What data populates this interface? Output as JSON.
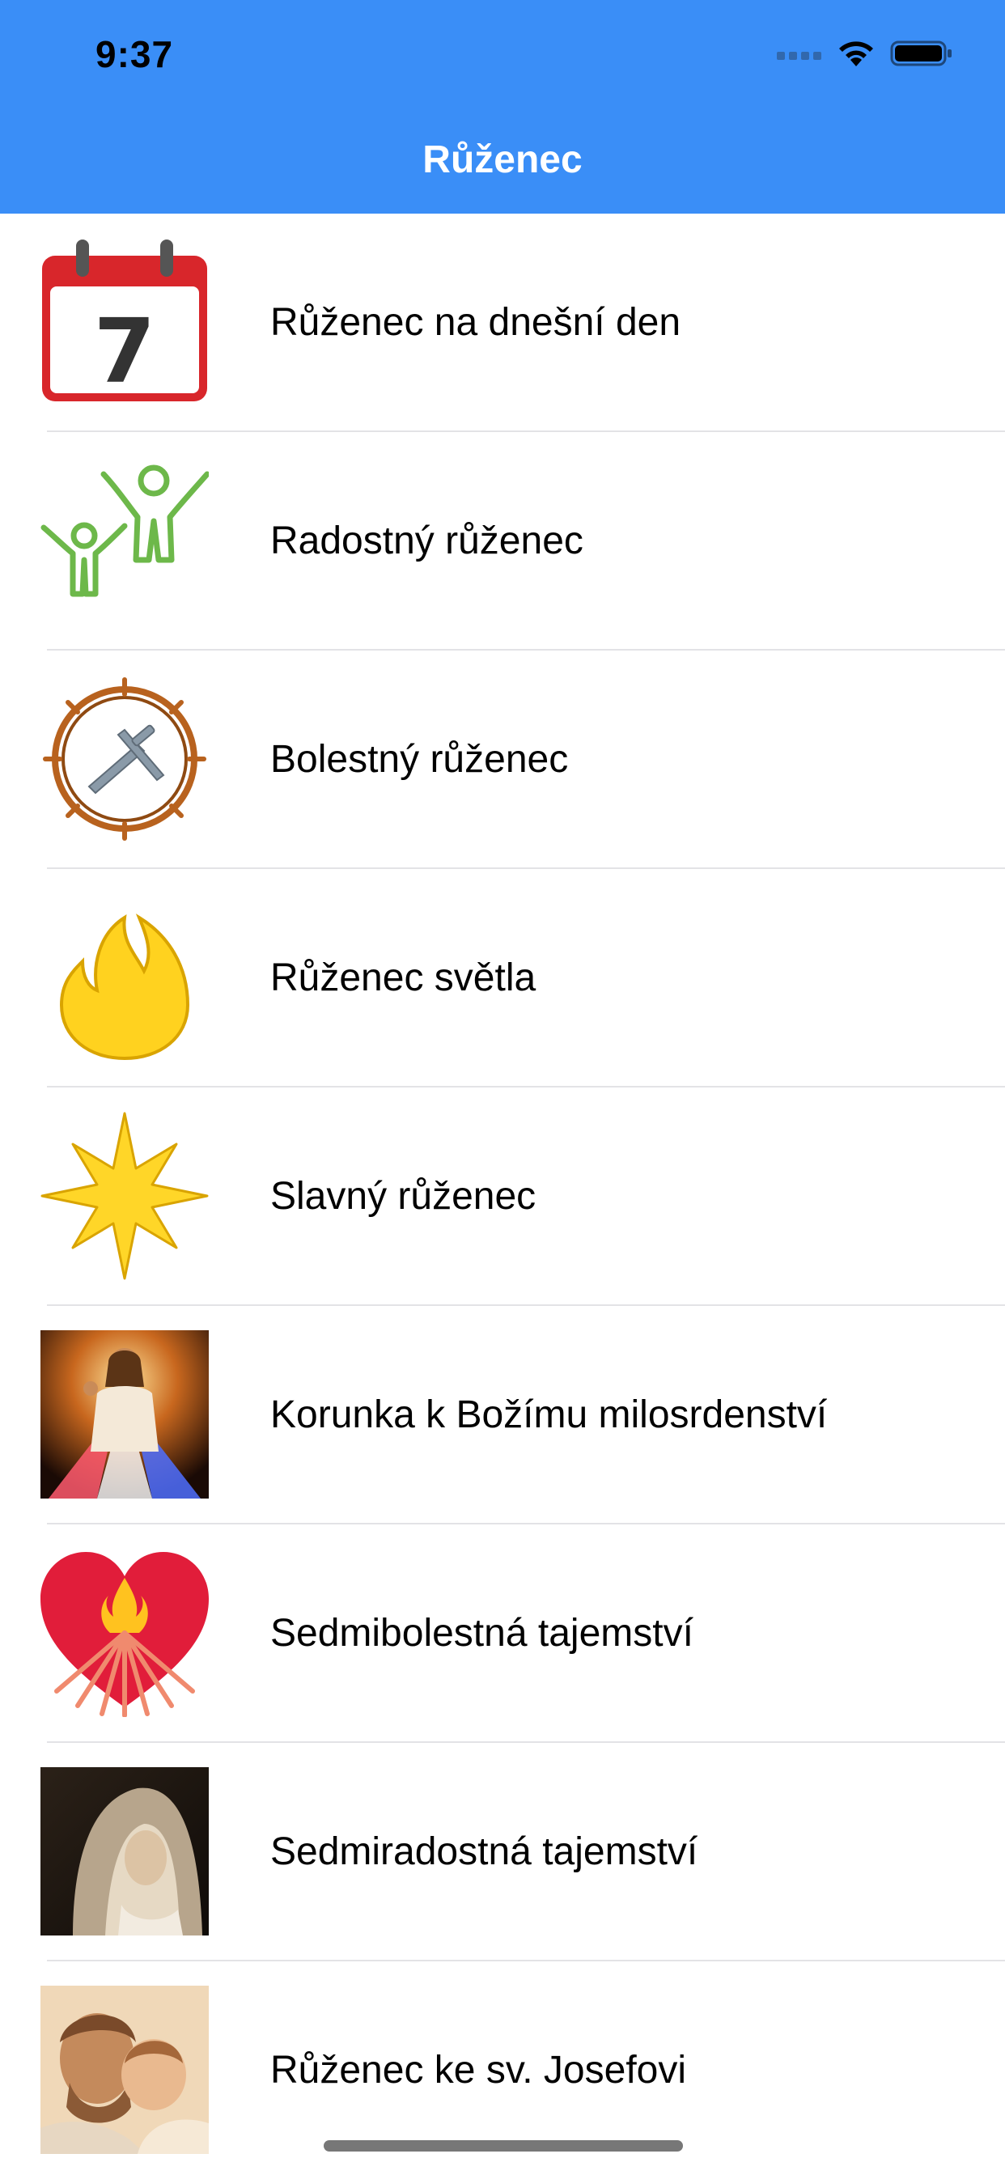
{
  "status_bar": {
    "time": "9:37"
  },
  "nav": {
    "title": "Růženec"
  },
  "calendar_icon_day": "7",
  "items": [
    {
      "label": "Růženec na dnešní den",
      "icon": "calendar-icon"
    },
    {
      "label": "Radostný růženec",
      "icon": "joyful-figures-icon"
    },
    {
      "label": "Bolestný růženec",
      "icon": "crown-of-thorns-icon"
    },
    {
      "label": "Růženec světla",
      "icon": "flame-icon"
    },
    {
      "label": "Slavný růženec",
      "icon": "star-icon"
    },
    {
      "label": "Korunka k Božímu milosrdenství",
      "icon": "divine-mercy-image"
    },
    {
      "label": "Sedmibolestná tajemství",
      "icon": "sorrowful-heart-icon"
    },
    {
      "label": "Sedmiradostná tajemství",
      "icon": "mary-image"
    },
    {
      "label": "Růženec ke sv. Josefovi",
      "icon": "saint-joseph-image"
    }
  ],
  "colors": {
    "header": "#3a8ef7",
    "separator": "#e3e3e6"
  }
}
